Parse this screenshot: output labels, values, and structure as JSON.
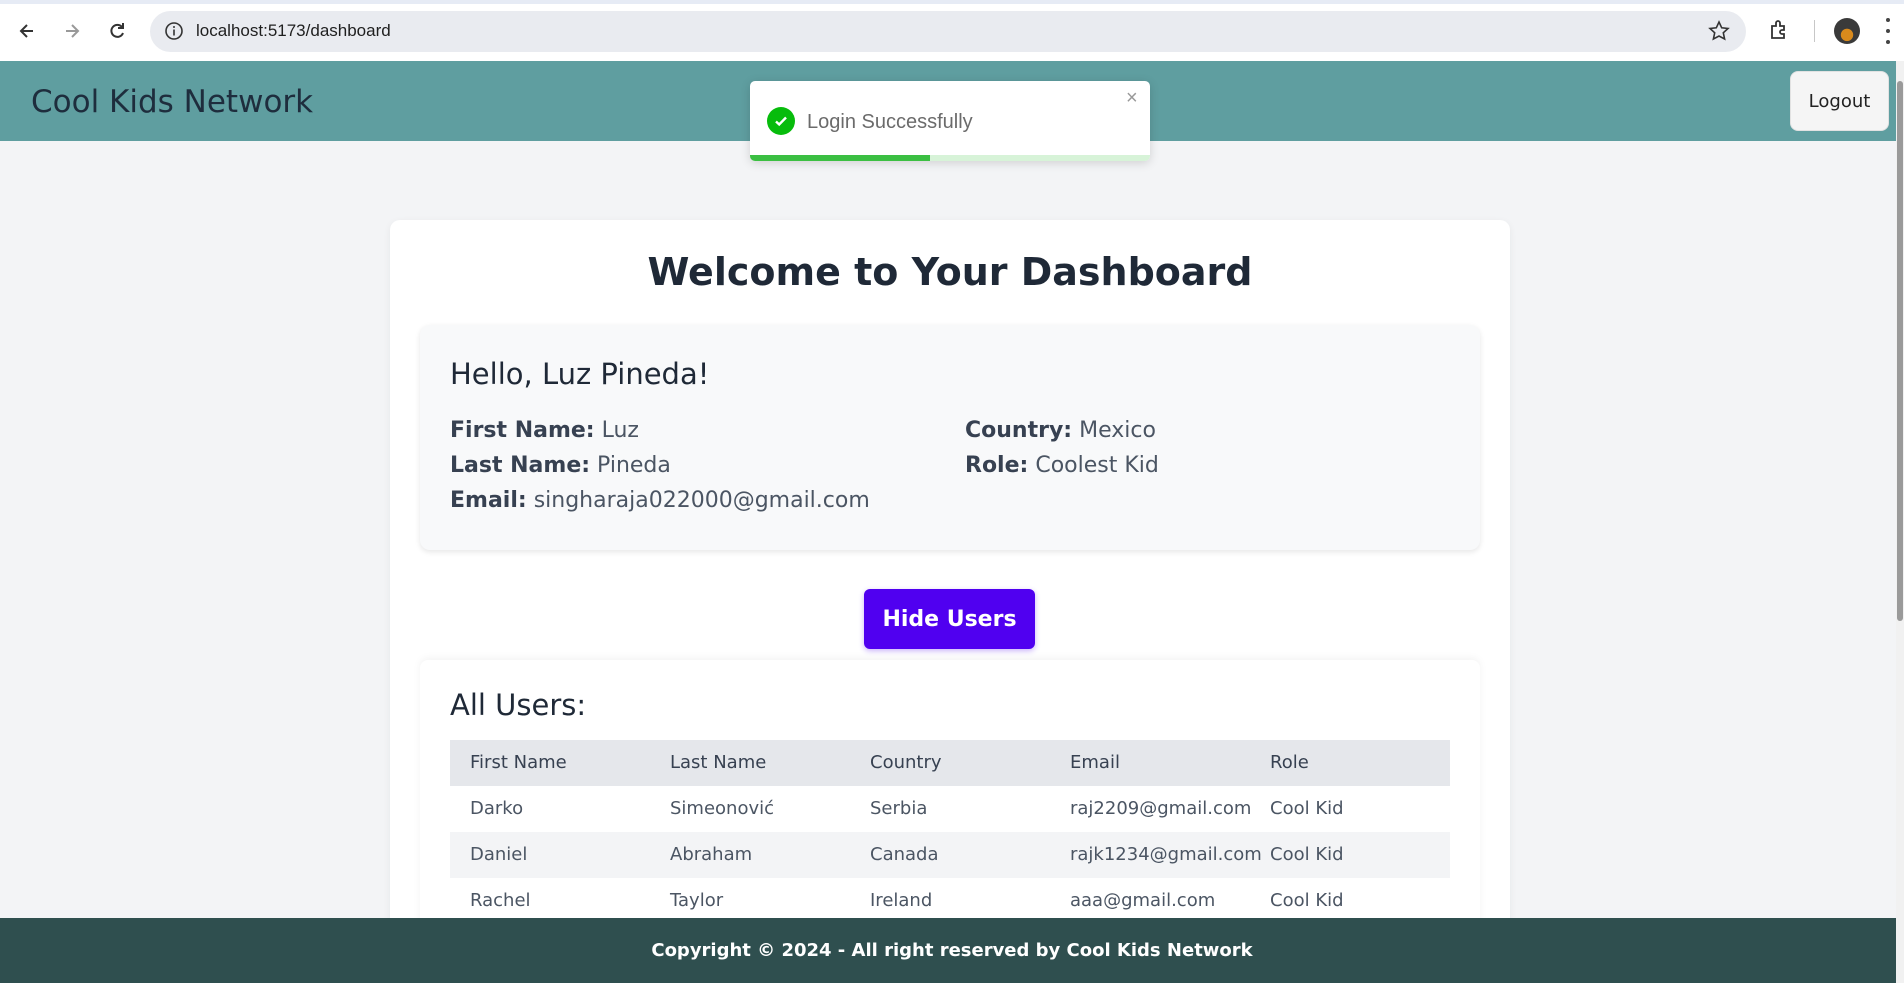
{
  "browser": {
    "url": "localhost:5173/dashboard",
    "icons": [
      "back-icon",
      "forward-icon",
      "reload-icon",
      "site-info-icon",
      "star-icon",
      "extensions-icon",
      "profile-avatar",
      "menu-icon"
    ]
  },
  "header": {
    "brand": "Cool Kids Network",
    "logout_label": "Logout",
    "color": "#5f9ea0"
  },
  "toast": {
    "message": "Login Successfully",
    "close": "×",
    "progress": 0.45,
    "color": "#07bc0c"
  },
  "dashboard": {
    "title": "Welcome to Your Dashboard",
    "greeting": "Hello, Luz Pineda!",
    "profile": {
      "first_name_label": "First Name:",
      "first_name": "Luz",
      "last_name_label": "Last Name:",
      "last_name": "Pineda",
      "email_label": "Email:",
      "email": "singharaja022000@gmail.com",
      "country_label": "Country:",
      "country": "Mexico",
      "role_label": "Role:",
      "role": "Coolest Kid"
    },
    "hide_users_label": "Hide Users",
    "accent_color": "#5000f0"
  },
  "users": {
    "title": "All Users:",
    "columns": [
      "First Name",
      "Last Name",
      "Country",
      "Email",
      "Role"
    ],
    "rows": [
      [
        "Darko",
        "Simeonović",
        "Serbia",
        "raj2209@gmail.com",
        "Cool Kid"
      ],
      [
        "Daniel",
        "Abraham",
        "Canada",
        "rajk1234@gmail.com",
        "Cool Kid"
      ],
      [
        "Rachel",
        "Taylor",
        "Ireland",
        "aaa@gmail.com",
        "Cool Kid"
      ]
    ]
  },
  "footer": {
    "text": "Copyright © 2024 - All right reserved by Cool Kids Network",
    "color": "#2f4f4f"
  }
}
